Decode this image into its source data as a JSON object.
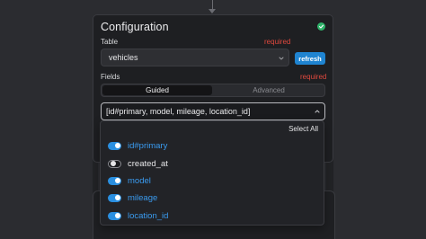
{
  "panel": {
    "title": "Configuration",
    "status_icon": "check-circle-icon",
    "status_color": "#2fb36a"
  },
  "table": {
    "label": "Table",
    "required": "required",
    "value": "vehicles",
    "refresh_label": "refresh"
  },
  "fields": {
    "label": "Fields",
    "required": "required",
    "modes": [
      "Guided",
      "Advanced"
    ],
    "active_mode": "Guided",
    "selection_text": "[id#primary, model, mileage, location_id]"
  },
  "dropdown": {
    "select_all_label": "Select All",
    "options": [
      {
        "label": "id#primary",
        "selected": true
      },
      {
        "label": "created_at",
        "selected": false
      },
      {
        "label": "model",
        "selected": true
      },
      {
        "label": "mileage",
        "selected": true
      },
      {
        "label": "location_id",
        "selected": true
      }
    ]
  },
  "colors": {
    "accent": "#2a8fe0",
    "required": "#e0493e",
    "success": "#2fb36a"
  }
}
